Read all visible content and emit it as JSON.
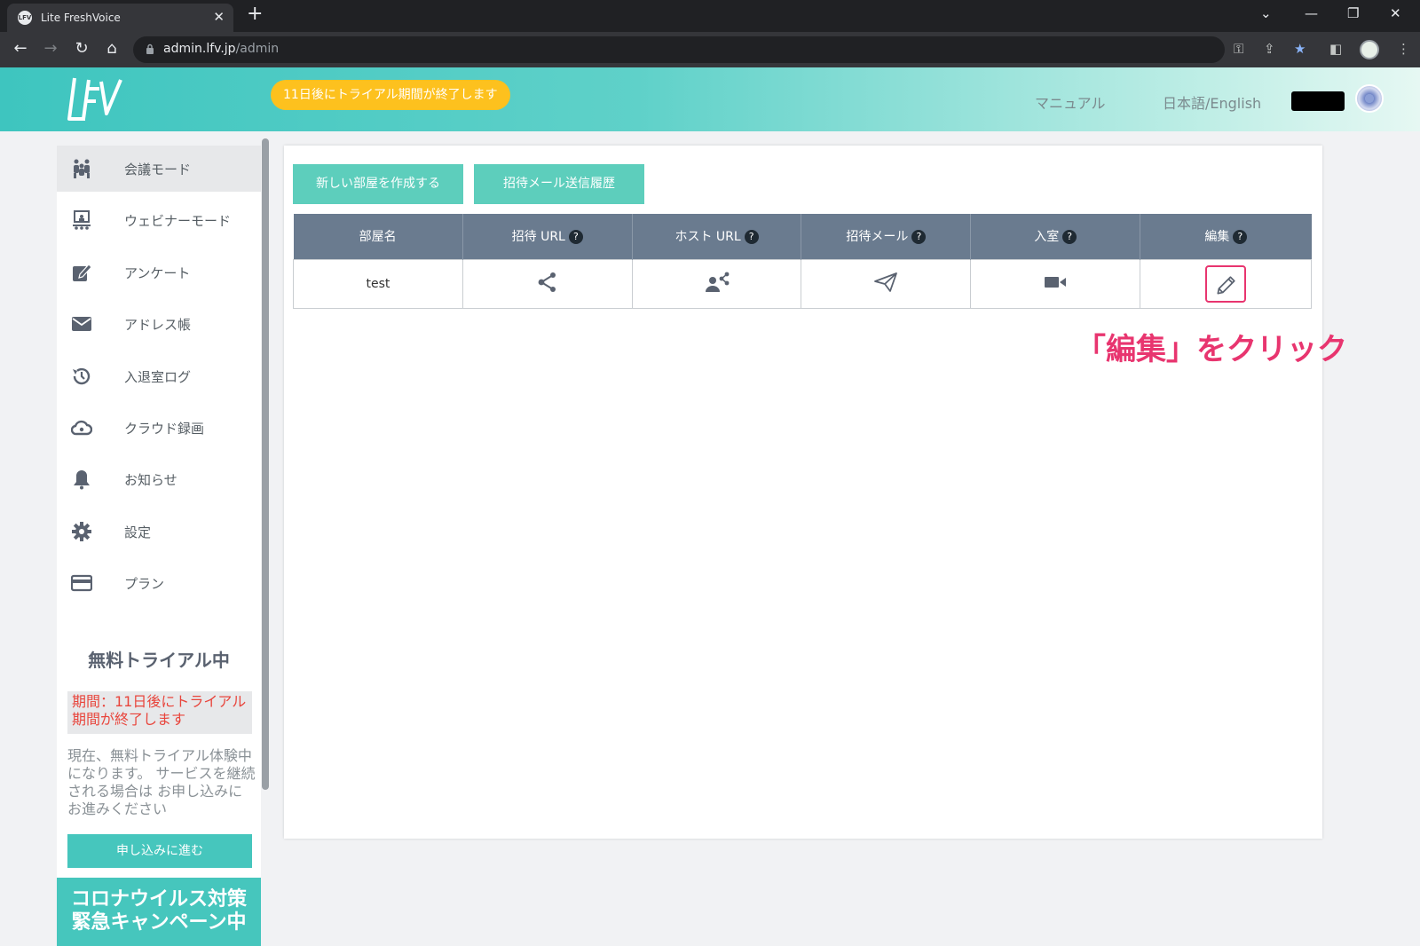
{
  "browser": {
    "tab_title": "Lite FreshVoice",
    "favicon_text": "LFV",
    "url_host": "admin.lfv.jp",
    "url_path": "/admin"
  },
  "header": {
    "trial_banner": "11日後にトライアル期間が終了します",
    "manual_link": "マニュアル",
    "language_link": "日本語/English"
  },
  "sidebar": {
    "items": [
      {
        "label": "会議モード",
        "icon": "people-icon",
        "active": true
      },
      {
        "label": "ウェビナーモード",
        "icon": "presentation-icon"
      },
      {
        "label": "アンケート",
        "icon": "edit-square-icon"
      },
      {
        "label": "アドレス帳",
        "icon": "envelope-icon"
      },
      {
        "label": "入退室ログ",
        "icon": "history-icon"
      },
      {
        "label": "クラウド録画",
        "icon": "cloud-icon"
      },
      {
        "label": "お知らせ",
        "icon": "bell-icon"
      },
      {
        "label": "設定",
        "icon": "gear-icon"
      },
      {
        "label": "プラン",
        "icon": "credit-card-icon"
      }
    ],
    "trial": {
      "title": "無料トライアル中",
      "alert": "期間：11日後にトライアル期間が終了します",
      "description": "現在、無料トライアル体験中 になります。 サービスを継続される場合は お申し込みにお進みください",
      "apply_button": "申し込みに進む"
    },
    "campaign": {
      "line1": "コロナウイルス対策",
      "line2": "緊急キャンペーン中"
    }
  },
  "main": {
    "create_room_button": "新しい部屋を作成する",
    "invite_history_button": "招待メール送信履歴",
    "table": {
      "columns": [
        {
          "label": "部屋名",
          "help": false
        },
        {
          "label": "招待 URL",
          "help": true
        },
        {
          "label": "ホスト URL",
          "help": true
        },
        {
          "label": "招待メール",
          "help": true
        },
        {
          "label": "入室",
          "help": true
        },
        {
          "label": "編集",
          "help": true
        }
      ],
      "help_mark": "?",
      "rows": [
        {
          "room_name": "test"
        }
      ]
    }
  },
  "annotation": "「編集」をクリック",
  "colors": {
    "accent": "#46c6bd",
    "trial_banner": "#fdc11e",
    "table_header": "#6a7b8f",
    "annotation": "#e8356f"
  }
}
